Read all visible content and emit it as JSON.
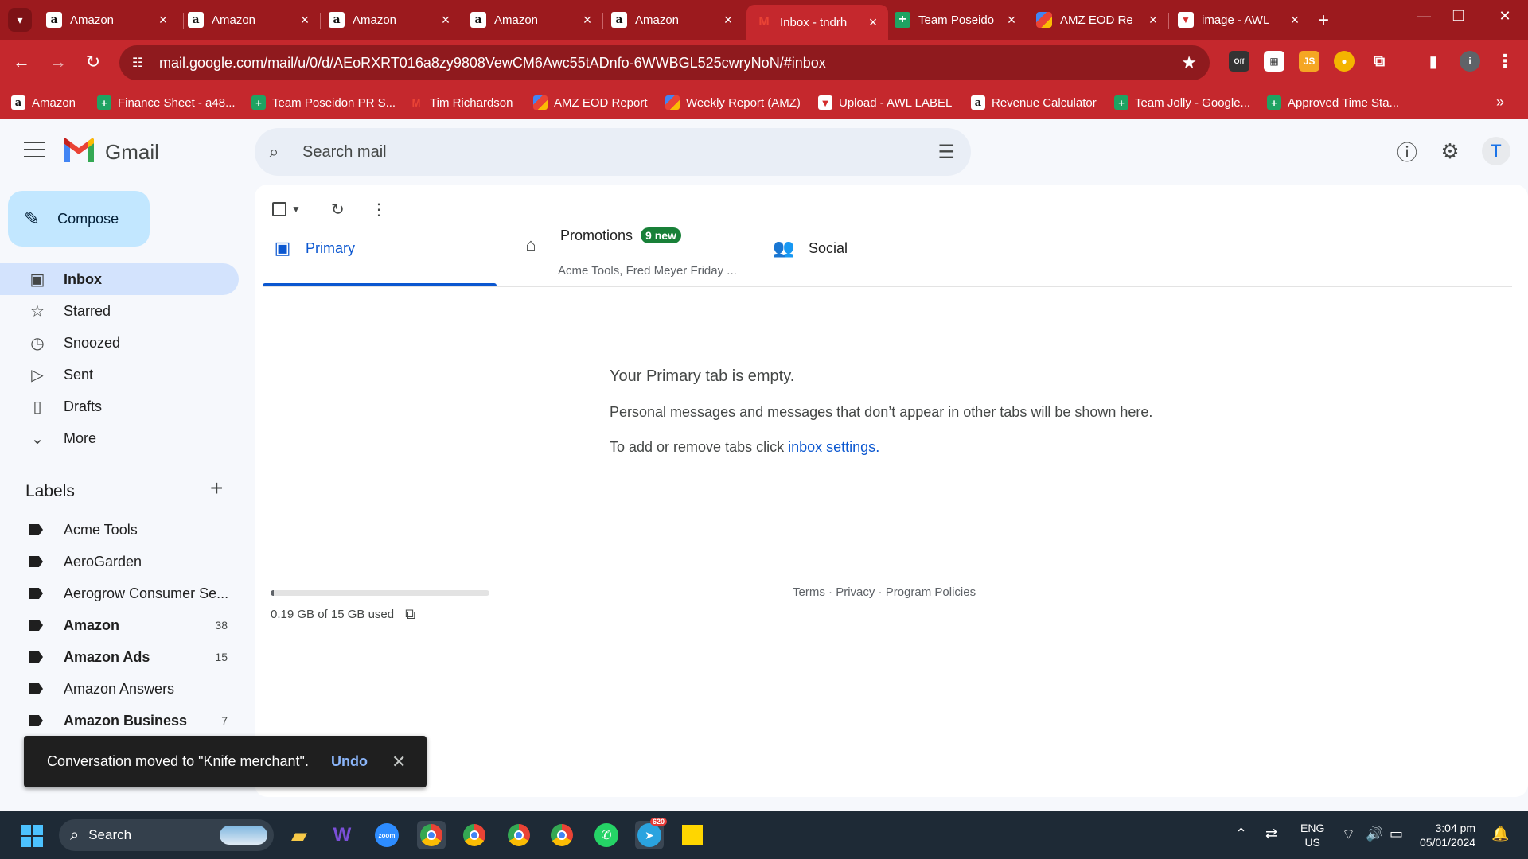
{
  "browser": {
    "tabs": [
      {
        "title": "Amazon",
        "favicon": "amazon-icon",
        "active": false
      },
      {
        "title": "Amazon",
        "favicon": "amazon-icon",
        "active": false
      },
      {
        "title": "Amazon",
        "favicon": "amazon-icon",
        "active": false
      },
      {
        "title": "Amazon",
        "favicon": "amazon-icon",
        "active": false
      },
      {
        "title": "Amazon",
        "favicon": "amazon-icon",
        "active": false
      },
      {
        "title": "Inbox - tndrh",
        "favicon": "gmail-icon",
        "active": true
      },
      {
        "title": "Team Poseido",
        "favicon": "sheets-icon",
        "active": false
      },
      {
        "title": "AMZ EOD Re",
        "favicon": "multicolor-icon",
        "active": false
      },
      {
        "title": "image - AWL",
        "favicon": "red-logo-icon",
        "active": false
      }
    ],
    "url": "mail.google.com/mail/u/0/d/AEoRXRT016a8zy9808VewCM6Awc55tADnfo-6WWBGL525cwryNoN/#inbox",
    "extension_badge_off": "Off",
    "extension_js_label": "JS",
    "profile_letter": "i",
    "bookmarks": [
      {
        "label": "Amazon",
        "favicon": "amazon-icon"
      },
      {
        "label": "Finance Sheet - a48...",
        "favicon": "sheets-icon"
      },
      {
        "label": "Team Poseidon PR S...",
        "favicon": "sheets-icon"
      },
      {
        "label": "Tim Richardson",
        "favicon": "gmail-icon"
      },
      {
        "label": "AMZ EOD Report",
        "favicon": "multicolor-icon"
      },
      {
        "label": "Weekly Report (AMZ)",
        "favicon": "multicolor-icon"
      },
      {
        "label": "Upload - AWL LABEL",
        "favicon": "red-logo-icon"
      },
      {
        "label": "Revenue Calculator",
        "favicon": "amazon-icon"
      },
      {
        "label": "Team Jolly - Google...",
        "favicon": "sheets-icon"
      },
      {
        "label": "Approved Time Sta...",
        "favicon": "sheets-icon"
      }
    ],
    "theme_color": "#c5282d",
    "tabstrip_color": "#9c1a1e"
  },
  "gmail": {
    "app_name": "Gmail",
    "search_placeholder": "Search mail",
    "avatar_letter": "T",
    "compose_label": "Compose",
    "nav": [
      {
        "label": "Inbox",
        "icon": "inbox-icon",
        "active": true
      },
      {
        "label": "Starred",
        "icon": "star-icon",
        "active": false
      },
      {
        "label": "Snoozed",
        "icon": "clock-icon",
        "active": false
      },
      {
        "label": "Sent",
        "icon": "send-icon",
        "active": false
      },
      {
        "label": "Drafts",
        "icon": "draft-icon",
        "active": false
      },
      {
        "label": "More",
        "icon": "chevron-down-icon",
        "active": false
      }
    ],
    "labels_title": "Labels",
    "labels": [
      {
        "name": "Acme Tools",
        "count": "",
        "bold": false
      },
      {
        "name": "AeroGarden",
        "count": "",
        "bold": false
      },
      {
        "name": "Aerogrow Consumer Se...",
        "count": "",
        "bold": false
      },
      {
        "name": "Amazon",
        "count": "38",
        "bold": true
      },
      {
        "name": "Amazon Ads",
        "count": "15",
        "bold": true
      },
      {
        "name": "Amazon Answers",
        "count": "",
        "bold": false
      },
      {
        "name": "Amazon Business",
        "count": "7",
        "bold": true
      }
    ],
    "category_tabs": {
      "primary": "Primary",
      "promotions": "Promotions",
      "promotions_badge": "9 new",
      "promotions_snippet": "Acme Tools, Fred Meyer Friday ...",
      "social": "Social"
    },
    "empty_state": {
      "title": "Your Primary tab is empty.",
      "body": "Personal messages and messages that don’t appear in other tabs will be shown here.",
      "settings_prefix": "To add or remove tabs click ",
      "settings_link": "inbox settings",
      "settings_suffix": "."
    },
    "storage": {
      "text": "0.19 GB of 15 GB used",
      "used_fraction": 0.013
    },
    "footer": {
      "terms": "Terms",
      "privacy": "Privacy",
      "policies": "Program Policies"
    },
    "snackbar": {
      "message": "Conversation moved to \"Knife merchant\".",
      "undo": "Undo"
    }
  },
  "taskbar": {
    "search_label": "Search",
    "telegram_badge": "620",
    "lang_line1": "ENG",
    "lang_line2": "US",
    "time": "3:04 pm",
    "date": "05/01/2024"
  }
}
